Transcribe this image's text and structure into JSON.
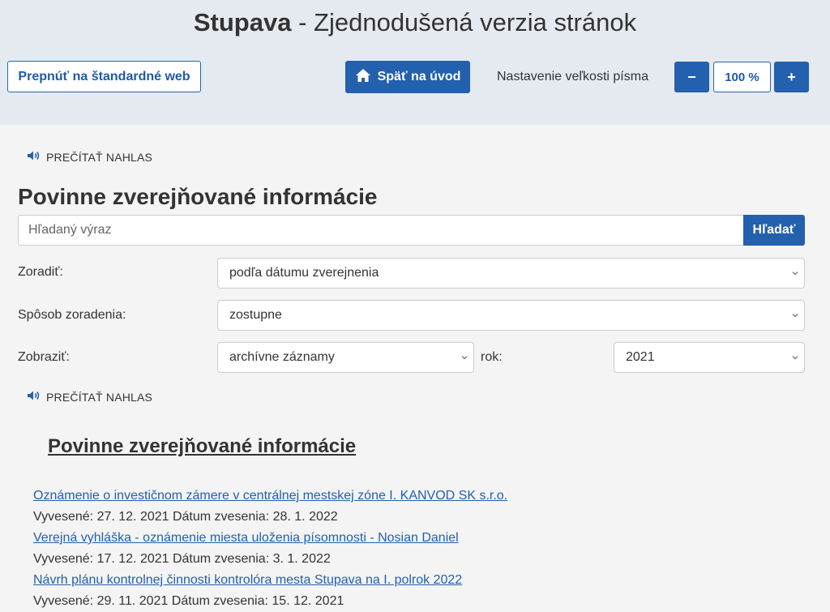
{
  "header": {
    "site_name": "Stupava",
    "site_subtitle": " - Zjednodušená verzia stránok",
    "switch_label": "Prepnúť na štandardné web",
    "home_label": "Späť na úvod",
    "font_size_label": "Nastavenie veľkosti písma",
    "font_decrease": "−",
    "font_value": "100 %",
    "font_increase": "+"
  },
  "read_aloud_label": "PREČÍTAŤ NAHLAS",
  "page_title": "Povinne zverejňované informácie",
  "search": {
    "placeholder": "Hľadaný výraz",
    "button_label": "Hľadať"
  },
  "filters": {
    "sort_label": "Zoradiť:",
    "sort_value": "podľa dátumu zverejnenia",
    "order_label": "Spôsob zoradenia:",
    "order_value": "zostupne",
    "show_label": "Zobraziť:",
    "show_value": "archívne záznamy",
    "year_label": "rok:",
    "year_value": "2021"
  },
  "section_title": "Povinne zverejňované informácie",
  "items": [
    {
      "title": "Oznámenie o investičnom zámere v centrálnej mestskej zóne I. KANVOD SK s.r.o.",
      "meta": "Vyvesené: 27. 12. 2021 Dátum zvesenia: 28. 1. 2022"
    },
    {
      "title": "Verejná vyhláška - oznámenie miesta uloženia písomnosti - Nosian Daniel",
      "meta": "Vyvesené: 17. 12. 2021 Dátum zvesenia: 3. 1. 2022"
    },
    {
      "title": "Návrh plánu kontrolnej činnosti kontrolóra mesta Stupava na I. polrok 2022",
      "meta": "Vyvesené: 29. 11. 2021 Dátum zvesenia: 15. 12. 2021"
    }
  ],
  "icons": {
    "home": "home-icon",
    "speaker": "speaker-icon",
    "chevron": "chevron-down-icon"
  },
  "colors": {
    "primary": "#2360ad",
    "header_bg": "#e5eaf0",
    "page_bg": "#f4f4f4"
  }
}
